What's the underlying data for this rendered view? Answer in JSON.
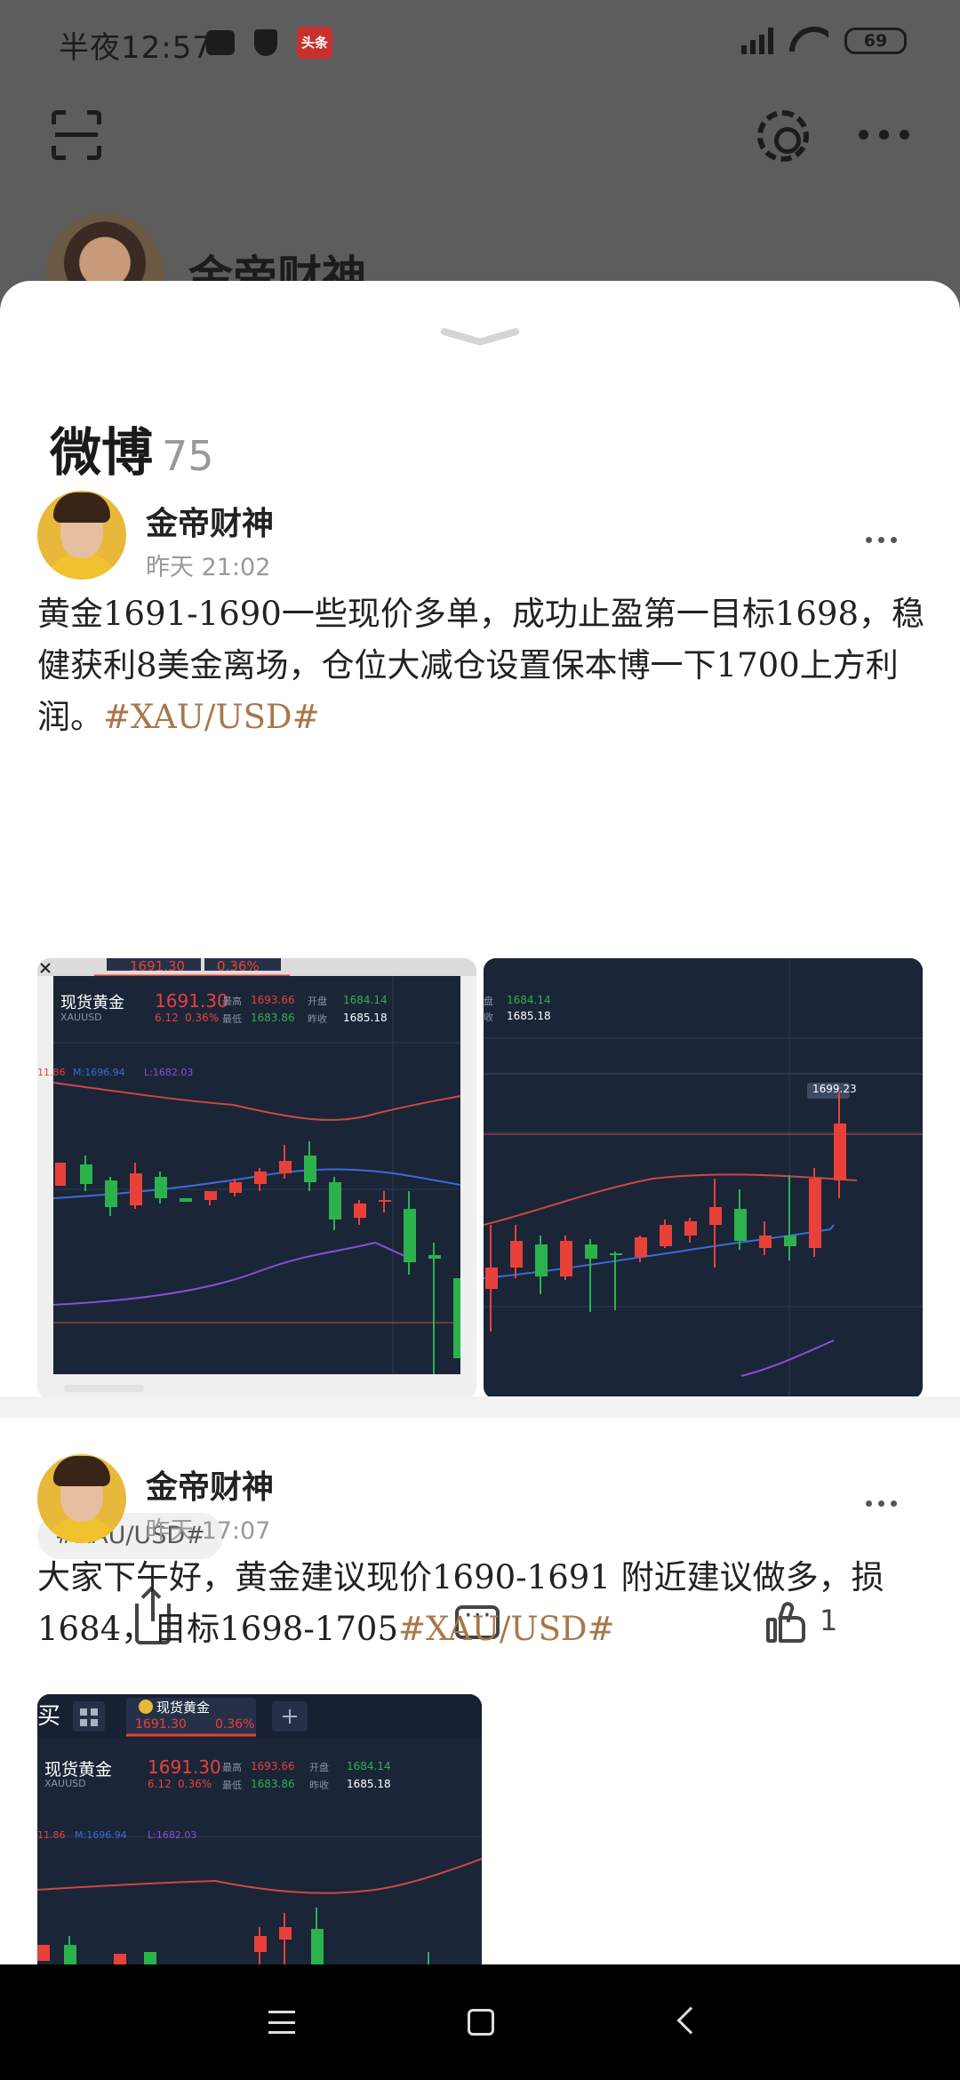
{
  "status_bar": {
    "time": "半夜12:57",
    "battery": "69",
    "news_app_label": "头条"
  },
  "profile": {
    "name": "金帝财神"
  },
  "section": {
    "title": "微博",
    "count": "75"
  },
  "posts": [
    {
      "author": "金帝财神",
      "time": "昨天 21:02",
      "text": "黄金1691-1690一些现价多单，成功止盈第一目标1698，稳健获利8美金离场，仓位大减仓设置保本博一下1700上方利润。",
      "hashtag": "#XAU/USD#",
      "chip": "#XAU/USD#",
      "like_count": "1",
      "chart_left": {
        "tab_price": "1691.30",
        "tab_pct": "0.36%",
        "symbol_name": "现货黄金",
        "symbol_code": "XAUUSD",
        "price": "1691.30",
        "change": "6.12",
        "change_pct": "0.36%",
        "high_label": "最高",
        "high": "1693.66",
        "low_label": "最低",
        "low": "1683.86",
        "open_label": "开盘",
        "open": "1684.14",
        "prev_label": "昨收",
        "prev": "1685.18",
        "ma_u": "11.86",
        "ma_m": "M:1696.94",
        "ma_l": "L:1682.03"
      },
      "chart_right": {
        "open": "1684.14",
        "prev": "1685.18",
        "price_tag": "1699.23",
        "open_label": "盘",
        "prev_label": "收"
      }
    },
    {
      "author": "金帝财神",
      "time": "昨天 17:07",
      "text": "大家下午好，黄金建议现价1690-1691 附近建议做多，损1684，目标1698-1705",
      "hashtag": "#XAU/USD#",
      "chart": {
        "corner_text": "买",
        "tab_name": "现货黄金",
        "tab_price": "1691.30",
        "tab_pct": "0.36%",
        "symbol_name": "现货黄金",
        "symbol_code": "XAUUSD",
        "price": "1691.30",
        "change": "6.12",
        "change_pct": "0.36%",
        "high_label": "最高",
        "high": "1693.66",
        "low_label": "最低",
        "low": "1683.86",
        "open_label": "开盘",
        "open": "1684.14",
        "prev_label": "昨收",
        "prev": "1685.18",
        "ma_u": "11.86",
        "ma_m": "M:1696.94",
        "ma_l": "L:1682.03"
      }
    }
  ],
  "colors": {
    "hashtag": "#a9784a",
    "chart_bg": "#1b2538",
    "up": "#e8413a",
    "down": "#2bb24c"
  }
}
